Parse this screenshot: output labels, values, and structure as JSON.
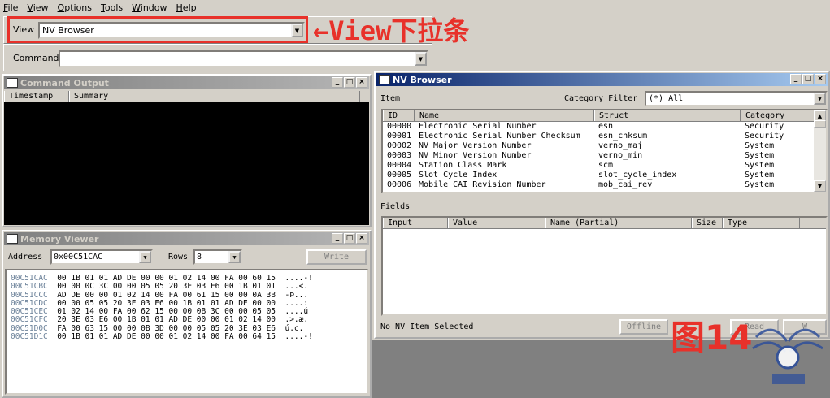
{
  "menu": [
    "File",
    "View",
    "Options",
    "Tools",
    "Window",
    "Help"
  ],
  "toolbar": {
    "view_label": "View",
    "view_value": "NV Browser",
    "command_label": "Command",
    "command_value": ""
  },
  "annotation": {
    "text": "←View下拉条",
    "color": "#e8312a"
  },
  "command_output": {
    "title": "Command Output",
    "columns": [
      "Timestamp",
      "Summary"
    ]
  },
  "memory_viewer": {
    "title": "Memory Viewer",
    "address_label": "Address",
    "address_value": "0x00C51CAC",
    "rows_label": "Rows",
    "rows_value": "8",
    "write_label": "Write",
    "lines": [
      {
        "addr": "00C51CAC",
        "hex": "00 1B 01 01 AD DE 00 00 01 02 14 00 FA 00 60 15",
        "ascii": "....-!"
      },
      {
        "addr": "00C51CBC",
        "hex": "00 00 0C 3C 00 00 05 05 20 3E 03 E6 00 1B 01 01",
        "ascii": "...<."
      },
      {
        "addr": "00C51CCC",
        "hex": "AD DE 00 00 01 02 14 00 FA 00 61 15 00 00 0A 3B",
        "ascii": "-Þ..."
      },
      {
        "addr": "00C51CDC",
        "hex": "00 00 05 05 20 3E 03 E6 00 1B 01 01 AD DE 00 00",
        "ascii": "....:"
      },
      {
        "addr": "00C51CEC",
        "hex": "01 02 14 00 FA 00 62 15 00 00 0B 3C 00 00 05 05",
        "ascii": "....ú"
      },
      {
        "addr": "00C51CFC",
        "hex": "20 3E 03 E6 00 1B 01 01 AD DE 00 00 01 02 14 00",
        "ascii": ".>.æ."
      },
      {
        "addr": "00C51D0C",
        "hex": "FA 00 63 15 00 00 0B 3D 00 00 05 05 20 3E 03 E6",
        "ascii": "ú.c."
      },
      {
        "addr": "00C51D1C",
        "hex": "00 1B 01 01 AD DE 00 00 01 02 14 00 FA 00 64 15",
        "ascii": "....-!"
      }
    ]
  },
  "nv_browser": {
    "title": "NV Browser",
    "item_label": "Item",
    "category_filter_label": "Category Filter",
    "category_filter_value": "(*) All",
    "columns": [
      "ID",
      "Name",
      "Struct",
      "Category"
    ],
    "rows": [
      {
        "id": "00000",
        "name": "Electronic Serial Number",
        "struct": "esn",
        "category": "Security"
      },
      {
        "id": "00001",
        "name": "Electronic Serial Number Checksum",
        "struct": "esn_chksum",
        "category": "Security"
      },
      {
        "id": "00002",
        "name": "NV Major Version Number",
        "struct": "verno_maj",
        "category": "System"
      },
      {
        "id": "00003",
        "name": "NV Minor Version Number",
        "struct": "verno_min",
        "category": "System"
      },
      {
        "id": "00004",
        "name": "Station Class Mark",
        "struct": "scm",
        "category": "System"
      },
      {
        "id": "00005",
        "name": "Slot Cycle Index",
        "struct": "slot_cycle_index",
        "category": "System"
      },
      {
        "id": "00006",
        "name": "Mobile CAI Revision Number",
        "struct": "mob_cai_rev",
        "category": "System"
      }
    ],
    "fields_label": "Fields",
    "field_columns": [
      "Input",
      "Value",
      "Name (Partial)",
      "Size",
      "Type"
    ],
    "status": "No NV Item Selected",
    "buttons": [
      "Offline",
      "Read",
      "W"
    ]
  },
  "figure_label": "图14"
}
